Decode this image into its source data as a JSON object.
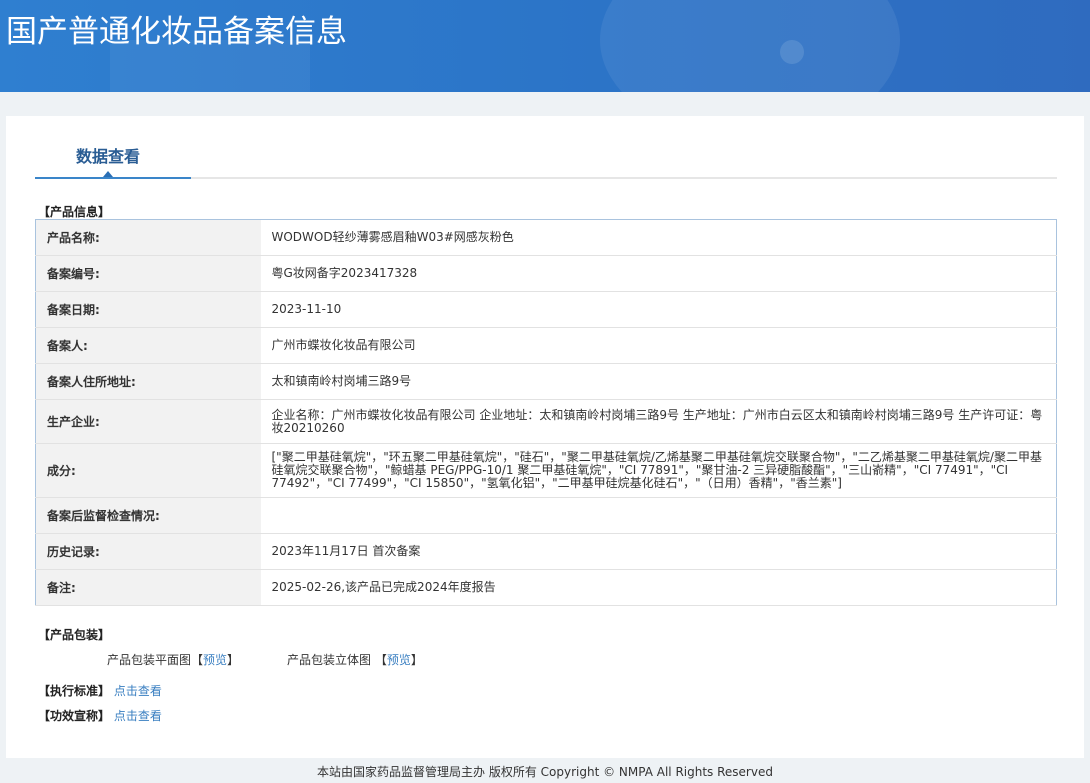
{
  "header": {
    "title": "国产普通化妆品备案信息"
  },
  "tab": "数据查看",
  "product_info": {
    "section_title": "【产品信息】",
    "rows": [
      {
        "label": "产品名称:",
        "value": "WODWOD轻纱薄雾感眉釉W03#网感灰粉色"
      },
      {
        "label": "备案编号:",
        "value": "粤G妆网备字2023417328"
      },
      {
        "label": "备案日期:",
        "value": "2023-11-10"
      },
      {
        "label": "备案人:",
        "value": "广州市蝶妆化妆品有限公司"
      },
      {
        "label": "备案人住所地址:",
        "value": "太和镇南岭村岗埔三路9号"
      },
      {
        "label": "生产企业:",
        "value": "企业名称：广州市蝶妆化妆品有限公司 企业地址：太和镇南岭村岗埔三路9号 生产地址：广州市白云区太和镇南岭村岗埔三路9号 生产许可证：粤妆20210260"
      },
      {
        "label": "成分:",
        "value": "[\"聚二甲基硅氧烷\"，\"环五聚二甲基硅氧烷\"，\"硅石\"，\"聚二甲基硅氧烷/乙烯基聚二甲基硅氧烷交联聚合物\"，\"二乙烯基聚二甲基硅氧烷/聚二甲基硅氧烷交联聚合物\"，\"鲸蜡基 PEG/PPG-10/1 聚二甲基硅氧烷\"，\"CI 77891\"，\"聚甘油-2 三异硬脂酸酯\"，\"三山嵛精\"，\"CI 77491\"，\"CI 77492\"，\"CI 77499\"，\"CI 15850\"，\"氢氧化铝\"，\"二甲基甲硅烷基化硅石\"，\"（日用）香精\"，\"香兰素\"]"
      },
      {
        "label": "备案后监督检查情况:",
        "value": ""
      },
      {
        "label": "历史记录:",
        "value": "2023年11月17日 首次备案"
      },
      {
        "label": "备注:",
        "value": "2025-02-26,该产品已完成2024年度报告"
      }
    ]
  },
  "packaging": {
    "section_title": "【产品包装】",
    "flat_label": "产品包装平面图",
    "flat_link": "预览",
    "solid_label": "产品包装立体图",
    "solid_link": "预览",
    "lb": "【",
    "rb": "】"
  },
  "standard": {
    "label": "【执行标准】",
    "link": "点击查看"
  },
  "efficacy": {
    "label": "【功效宣称】",
    "link": "点击查看"
  },
  "footer": "本站由国家药品监督管理局主办 版权所有 Copyright © NMPA All Rights Reserved"
}
